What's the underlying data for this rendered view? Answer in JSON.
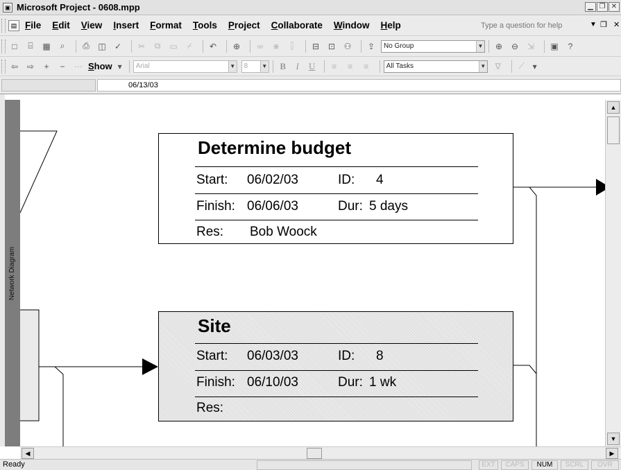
{
  "window": {
    "title": "Microsoft Project - 0608.mpp"
  },
  "menu": {
    "items": [
      "File",
      "Edit",
      "View",
      "Insert",
      "Format",
      "Tools",
      "Project",
      "Collaborate",
      "Window",
      "Help"
    ],
    "help_placeholder": "Type a question for help"
  },
  "toolbar_standard": {
    "group_value": "No Group"
  },
  "toolbar_formatting": {
    "show_label": "Show",
    "font_value": "Arial",
    "size_value": "8",
    "bold": "B",
    "italic": "I",
    "underline": "U",
    "filter_value": "All Tasks"
  },
  "entry_bar": {
    "value": "06/13/03"
  },
  "view_bar": {
    "label": "Network Diagram"
  },
  "tasks": [
    {
      "name": "Determine budget",
      "start_label": "Start:",
      "start": "06/02/03",
      "id_label": "ID:",
      "id": "4",
      "finish_label": "Finish:",
      "finish": "06/06/03",
      "dur_label": "Dur:",
      "duration": "5 days",
      "res_label": "Res:",
      "resource": "Bob Woock"
    },
    {
      "name": "Site",
      "start_label": "Start:",
      "start": "06/03/03",
      "id_label": "ID:",
      "id": "8",
      "finish_label": "Finish:",
      "finish": "06/10/03",
      "dur_label": "Dur:",
      "duration": "1 wk",
      "res_label": "Res:",
      "resource": ""
    }
  ],
  "status": {
    "ready": "Ready",
    "indicators": [
      {
        "label": "EXT",
        "active": false
      },
      {
        "label": "CAPS",
        "active": false
      },
      {
        "label": "NUM",
        "active": true
      },
      {
        "label": "SCRL",
        "active": false
      },
      {
        "label": "OVR",
        "active": false
      }
    ]
  }
}
